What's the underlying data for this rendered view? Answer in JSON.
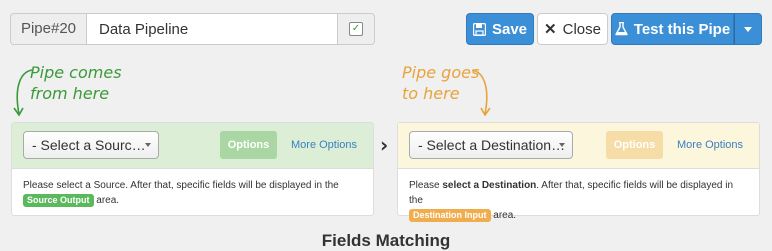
{
  "header": {
    "pipe_id": "Pipe#20",
    "pipe_name_value": "Data Pipeline",
    "save_label": "Save",
    "close_label": "Close",
    "test_label": "Test this Pipe"
  },
  "annotations": {
    "source_note_line1": "Pipe comes",
    "source_note_line2": "from here",
    "destination_note_line1": "Pipe goes",
    "destination_note_line2": "to here"
  },
  "source_panel": {
    "select_value": "- Select a Sourc…",
    "options_label": "Options",
    "more_options_label": "More Options",
    "help_text": "Please select a Source. After that, specific fields will be displayed in the",
    "tag_label": "Source Output",
    "help_suffix": "area."
  },
  "destination_panel": {
    "select_value": "- Select a Destination…",
    "options_label": "Options",
    "more_options_label": "More Options",
    "help_prefix": "Please",
    "help_bold": "select a Destination",
    "help_text": ". After that, specific fields will be displayed in the",
    "tag_label": "Destination Input",
    "help_suffix": "area."
  },
  "section": {
    "title": "Fields Matching"
  },
  "colors": {
    "primary": "#3a8fd6",
    "source_accent": "#5cb85c",
    "destination_accent": "#f0ad4e"
  }
}
